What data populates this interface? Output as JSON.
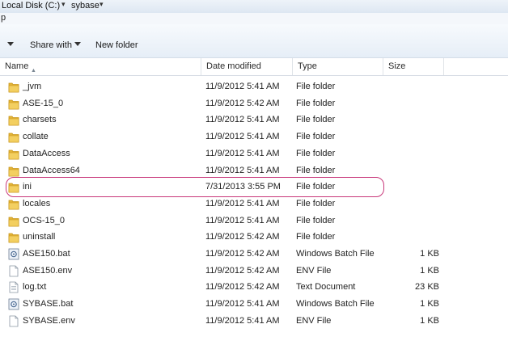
{
  "address": {
    "drive": "Local Disk (C:)",
    "folder": "sybase"
  },
  "menu_fragment": "p",
  "toolbar": {
    "share_label": "Share with",
    "new_folder_label": "New folder"
  },
  "columns": {
    "name": "Name",
    "date": "Date modified",
    "type": "Type",
    "size": "Size"
  },
  "files": [
    {
      "name": "_jvm",
      "date": "11/9/2012 5:41 AM",
      "type": "File folder",
      "size": "",
      "icon": "folder-icon"
    },
    {
      "name": "ASE-15_0",
      "date": "11/9/2012 5:42 AM",
      "type": "File folder",
      "size": "",
      "icon": "folder-icon"
    },
    {
      "name": "charsets",
      "date": "11/9/2012 5:41 AM",
      "type": "File folder",
      "size": "",
      "icon": "folder-icon"
    },
    {
      "name": "collate",
      "date": "11/9/2012 5:41 AM",
      "type": "File folder",
      "size": "",
      "icon": "folder-icon"
    },
    {
      "name": "DataAccess",
      "date": "11/9/2012 5:41 AM",
      "type": "File folder",
      "size": "",
      "icon": "folder-icon"
    },
    {
      "name": "DataAccess64",
      "date": "11/9/2012 5:41 AM",
      "type": "File folder",
      "size": "",
      "icon": "folder-icon"
    },
    {
      "name": "ini",
      "date": "7/31/2013 3:55 PM",
      "type": "File folder",
      "size": "",
      "icon": "folder-icon"
    },
    {
      "name": "locales",
      "date": "11/9/2012 5:41 AM",
      "type": "File folder",
      "size": "",
      "icon": "folder-icon"
    },
    {
      "name": "OCS-15_0",
      "date": "11/9/2012 5:41 AM",
      "type": "File folder",
      "size": "",
      "icon": "folder-icon"
    },
    {
      "name": "uninstall",
      "date": "11/9/2012 5:42 AM",
      "type": "File folder",
      "size": "",
      "icon": "folder-icon"
    },
    {
      "name": "ASE150.bat",
      "date": "11/9/2012 5:42 AM",
      "type": "Windows Batch File",
      "size": "1 KB",
      "icon": "batch-file-icon"
    },
    {
      "name": "ASE150.env",
      "date": "11/9/2012 5:42 AM",
      "type": "ENV File",
      "size": "1 KB",
      "icon": "file-icon"
    },
    {
      "name": "log.txt",
      "date": "11/9/2012 5:42 AM",
      "type": "Text Document",
      "size": "23 KB",
      "icon": "text-file-icon"
    },
    {
      "name": "SYBASE.bat",
      "date": "11/9/2012 5:41 AM",
      "type": "Windows Batch File",
      "size": "1 KB",
      "icon": "batch-file-icon"
    },
    {
      "name": "SYBASE.env",
      "date": "11/9/2012 5:41 AM",
      "type": "ENV File",
      "size": "1 KB",
      "icon": "file-icon"
    }
  ]
}
